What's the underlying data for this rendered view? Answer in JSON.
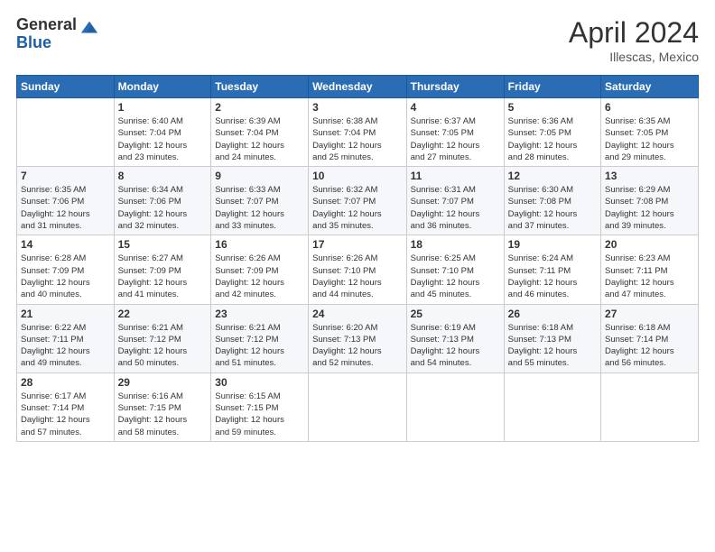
{
  "header": {
    "logo_line1": "General",
    "logo_line2": "Blue",
    "month": "April 2024",
    "location": "Illescas, Mexico"
  },
  "days_of_week": [
    "Sunday",
    "Monday",
    "Tuesday",
    "Wednesday",
    "Thursday",
    "Friday",
    "Saturday"
  ],
  "weeks": [
    [
      {
        "day": "",
        "info": ""
      },
      {
        "day": "1",
        "info": "Sunrise: 6:40 AM\nSunset: 7:04 PM\nDaylight: 12 hours\nand 23 minutes."
      },
      {
        "day": "2",
        "info": "Sunrise: 6:39 AM\nSunset: 7:04 PM\nDaylight: 12 hours\nand 24 minutes."
      },
      {
        "day": "3",
        "info": "Sunrise: 6:38 AM\nSunset: 7:04 PM\nDaylight: 12 hours\nand 25 minutes."
      },
      {
        "day": "4",
        "info": "Sunrise: 6:37 AM\nSunset: 7:05 PM\nDaylight: 12 hours\nand 27 minutes."
      },
      {
        "day": "5",
        "info": "Sunrise: 6:36 AM\nSunset: 7:05 PM\nDaylight: 12 hours\nand 28 minutes."
      },
      {
        "day": "6",
        "info": "Sunrise: 6:35 AM\nSunset: 7:05 PM\nDaylight: 12 hours\nand 29 minutes."
      }
    ],
    [
      {
        "day": "7",
        "info": "Sunrise: 6:35 AM\nSunset: 7:06 PM\nDaylight: 12 hours\nand 31 minutes."
      },
      {
        "day": "8",
        "info": "Sunrise: 6:34 AM\nSunset: 7:06 PM\nDaylight: 12 hours\nand 32 minutes."
      },
      {
        "day": "9",
        "info": "Sunrise: 6:33 AM\nSunset: 7:07 PM\nDaylight: 12 hours\nand 33 minutes."
      },
      {
        "day": "10",
        "info": "Sunrise: 6:32 AM\nSunset: 7:07 PM\nDaylight: 12 hours\nand 35 minutes."
      },
      {
        "day": "11",
        "info": "Sunrise: 6:31 AM\nSunset: 7:07 PM\nDaylight: 12 hours\nand 36 minutes."
      },
      {
        "day": "12",
        "info": "Sunrise: 6:30 AM\nSunset: 7:08 PM\nDaylight: 12 hours\nand 37 minutes."
      },
      {
        "day": "13",
        "info": "Sunrise: 6:29 AM\nSunset: 7:08 PM\nDaylight: 12 hours\nand 39 minutes."
      }
    ],
    [
      {
        "day": "14",
        "info": "Sunrise: 6:28 AM\nSunset: 7:09 PM\nDaylight: 12 hours\nand 40 minutes."
      },
      {
        "day": "15",
        "info": "Sunrise: 6:27 AM\nSunset: 7:09 PM\nDaylight: 12 hours\nand 41 minutes."
      },
      {
        "day": "16",
        "info": "Sunrise: 6:26 AM\nSunset: 7:09 PM\nDaylight: 12 hours\nand 42 minutes."
      },
      {
        "day": "17",
        "info": "Sunrise: 6:26 AM\nSunset: 7:10 PM\nDaylight: 12 hours\nand 44 minutes."
      },
      {
        "day": "18",
        "info": "Sunrise: 6:25 AM\nSunset: 7:10 PM\nDaylight: 12 hours\nand 45 minutes."
      },
      {
        "day": "19",
        "info": "Sunrise: 6:24 AM\nSunset: 7:11 PM\nDaylight: 12 hours\nand 46 minutes."
      },
      {
        "day": "20",
        "info": "Sunrise: 6:23 AM\nSunset: 7:11 PM\nDaylight: 12 hours\nand 47 minutes."
      }
    ],
    [
      {
        "day": "21",
        "info": "Sunrise: 6:22 AM\nSunset: 7:11 PM\nDaylight: 12 hours\nand 49 minutes."
      },
      {
        "day": "22",
        "info": "Sunrise: 6:21 AM\nSunset: 7:12 PM\nDaylight: 12 hours\nand 50 minutes."
      },
      {
        "day": "23",
        "info": "Sunrise: 6:21 AM\nSunset: 7:12 PM\nDaylight: 12 hours\nand 51 minutes."
      },
      {
        "day": "24",
        "info": "Sunrise: 6:20 AM\nSunset: 7:13 PM\nDaylight: 12 hours\nand 52 minutes."
      },
      {
        "day": "25",
        "info": "Sunrise: 6:19 AM\nSunset: 7:13 PM\nDaylight: 12 hours\nand 54 minutes."
      },
      {
        "day": "26",
        "info": "Sunrise: 6:18 AM\nSunset: 7:13 PM\nDaylight: 12 hours\nand 55 minutes."
      },
      {
        "day": "27",
        "info": "Sunrise: 6:18 AM\nSunset: 7:14 PM\nDaylight: 12 hours\nand 56 minutes."
      }
    ],
    [
      {
        "day": "28",
        "info": "Sunrise: 6:17 AM\nSunset: 7:14 PM\nDaylight: 12 hours\nand 57 minutes."
      },
      {
        "day": "29",
        "info": "Sunrise: 6:16 AM\nSunset: 7:15 PM\nDaylight: 12 hours\nand 58 minutes."
      },
      {
        "day": "30",
        "info": "Sunrise: 6:15 AM\nSunset: 7:15 PM\nDaylight: 12 hours\nand 59 minutes."
      },
      {
        "day": "",
        "info": ""
      },
      {
        "day": "",
        "info": ""
      },
      {
        "day": "",
        "info": ""
      },
      {
        "day": "",
        "info": ""
      }
    ]
  ]
}
